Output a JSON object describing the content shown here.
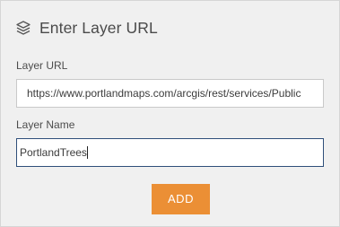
{
  "header": {
    "icon": "layers-icon",
    "title": "Enter Layer URL"
  },
  "fields": {
    "layer_url": {
      "label": "Layer URL",
      "value": "https://www.portlandmaps.com/arcgis/rest/services/Public"
    },
    "layer_name": {
      "label": "Layer Name",
      "value": "PortlandTrees"
    }
  },
  "actions": {
    "add_label": "ADD"
  },
  "colors": {
    "accent": "#eb8f35",
    "panel_bg": "#f0f0f0",
    "focus_border": "#2f4f7a"
  }
}
